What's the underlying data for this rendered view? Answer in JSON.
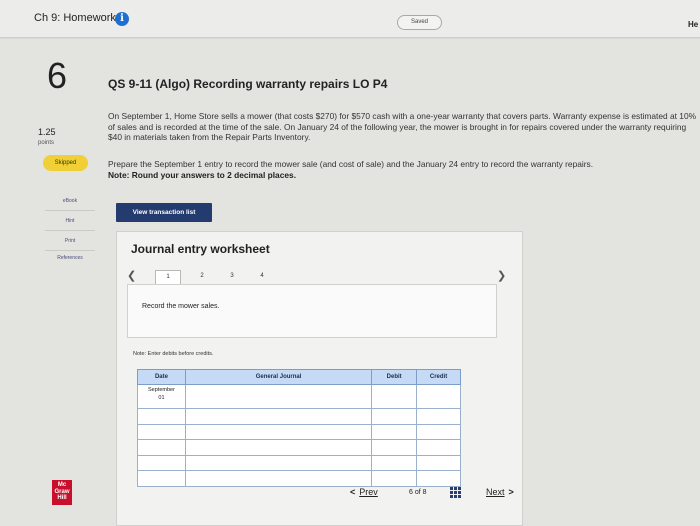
{
  "header": {
    "title": "Ch 9: Homework",
    "saved_label": "Saved",
    "right_text": "He"
  },
  "question": {
    "number": "6",
    "points_value": "1.25",
    "points_label": "points",
    "status": "Skipped",
    "title": "QS 9-11 (Algo) Recording warranty repairs LO P4",
    "body": "On September 1, Home Store sells a mower (that costs $270) for $570 cash with a one-year warranty that covers parts. Warranty expense is estimated at 10% of sales and is recorded at the time of the sale. On January 24 of the following year, the mower is brought in for repairs covered under the warranty requiring $40 in materials taken from the Repair Parts Inventory.",
    "instruction": "Prepare the September 1 entry to record the mower sale (and cost of sale) and the January 24 entry to record the warranty repairs.",
    "instruction_note": "Note: Round your answers to 2 decimal places."
  },
  "sidebar": {
    "items": [
      "eBook",
      "Hint",
      "Print",
      "References"
    ]
  },
  "view_transaction_button": "View transaction list",
  "worksheet": {
    "title": "Journal entry worksheet",
    "tabs": [
      "1",
      "2",
      "3",
      "4"
    ],
    "task": "Record the mower sales.",
    "note": "Note: Enter debits before credits.",
    "columns": [
      "Date",
      "General Journal",
      "Debit",
      "Credit"
    ],
    "first_date": "September 01"
  },
  "footer": {
    "logo": "Mc Graw Hill",
    "prev": "Prev",
    "page_current": "6",
    "page_of": "of",
    "page_total": "8",
    "next": "Next"
  },
  "colors": {
    "info_icon": "#1f6fd1",
    "skipped_badge": "#f0d036",
    "button_navy": "#233b6e",
    "table_header": "#c5daf4",
    "logo_red": "#c8102e"
  }
}
